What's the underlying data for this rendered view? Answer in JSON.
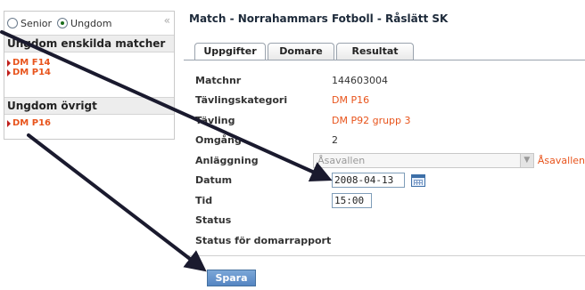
{
  "sidebar": {
    "filter": {
      "options": [
        {
          "label": "Senior",
          "checked": false
        },
        {
          "label": "Ungdom",
          "checked": true
        }
      ]
    },
    "sections": [
      {
        "title": "Ungdom enskilda matcher",
        "items": [
          "DM F14",
          "DM P14"
        ]
      },
      {
        "title": "Ungdom övrigt",
        "items": [
          "DM P16"
        ]
      }
    ]
  },
  "main": {
    "title": "Match - Norrahammars Fotboll - Råslätt SK",
    "tabs": [
      {
        "label": "Uppgifter",
        "active": true
      },
      {
        "label": "Domare",
        "active": false
      },
      {
        "label": "Resultat",
        "active": false
      }
    ],
    "form": {
      "matchnr": {
        "label": "Matchnr",
        "value": "144603004"
      },
      "kategori": {
        "label": "Tävlingskategori",
        "value": "DM P16"
      },
      "tavling": {
        "label": "Tävling",
        "value": "DM P92 grupp 3"
      },
      "omgang": {
        "label": "Omgång",
        "value": "2"
      },
      "anlaggning": {
        "label": "Anläggning",
        "value": "Åsavallen",
        "link": "Åsavallen"
      },
      "datum": {
        "label": "Datum",
        "value": "2008-04-13"
      },
      "tid": {
        "label": "Tid",
        "value": "15:00"
      },
      "status": {
        "label": "Status",
        "value": ""
      },
      "status_rapport": {
        "label": "Status för domarrapport",
        "value": ""
      }
    },
    "save_label": "Spara"
  },
  "colors": {
    "link": "#e8541c",
    "button": "#5e8ecb",
    "arrow": "#1a1a2e"
  }
}
